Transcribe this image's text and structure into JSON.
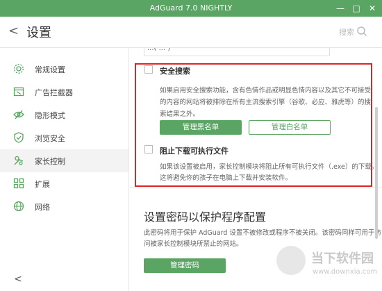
{
  "window": {
    "title": "AdGuard 7.0 NIGHTLY",
    "min": "—",
    "max": "□",
    "close": "✕"
  },
  "header": {
    "back": "<",
    "title": "设置",
    "search_label": "搜索"
  },
  "sidebar": {
    "items": [
      {
        "label": "常规设置",
        "icon": "gear-icon"
      },
      {
        "label": "广告拦截器",
        "icon": "ad-block-icon"
      },
      {
        "label": "隐形模式",
        "icon": "stealth-eye-icon"
      },
      {
        "label": "浏览安全",
        "icon": "shield-check-icon"
      },
      {
        "label": "家长控制",
        "icon": "parental-control-icon"
      },
      {
        "label": "扩展",
        "icon": "extensions-grid-icon"
      },
      {
        "label": "网络",
        "icon": "globe-icon"
      }
    ],
    "active_index": 4,
    "collapse": "<"
  },
  "content": {
    "prev_input_value": "...( ... )",
    "safe_search": {
      "title": "安全搜索",
      "desc1": "如果启用安全搜索功能，含有色情作品或明显色情内容以及其它不可接受",
      "desc2": "的内容的网站将被排除在所有主流搜索引擎（谷歌、必应、雅虎等）的搜",
      "desc3": "索结果之外。",
      "blacklist_btn": "管理黑名单",
      "whitelist_btn": "管理白名单"
    },
    "block_exe": {
      "title": "阻止下载可执行文件",
      "desc1": "如果该设置被启用，家长控制模块将阻止所有可执行文件（.exe）的下载。",
      "desc2": "这将避免你的孩子在电脑上下载并安装软件。"
    },
    "password": {
      "title": "设置密码以保护程序配置",
      "desc1": "此密码将用于保护 AdGuard 设置不被修改或程序不被关闭。该密码同样可用于访",
      "desc2": "问被家长控制模块所禁止的网站。",
      "button": "管理密码"
    }
  },
  "watermark": {
    "text": "当下软件园",
    "url": "www.downxia.com"
  },
  "colors": {
    "accent": "#5aa564",
    "highlight": "#e02424"
  }
}
